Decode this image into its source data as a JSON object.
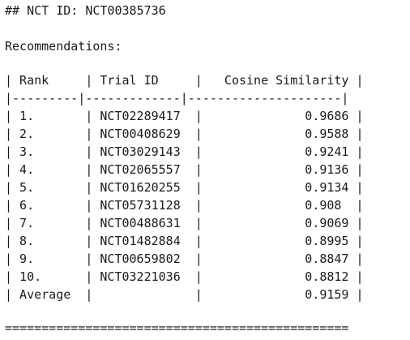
{
  "heading": "## NCT ID: NCT00385736",
  "recommendations_label": "Recommendations:",
  "table": {
    "header_line": "| Rank     | Trial ID     |   Cosine Similarity |",
    "separator_line": "|---------|-------------|---------------------|",
    "rows": [
      "| 1.       | NCT02289417  |              0.9686 |",
      "| 2.       | NCT00408629  |              0.9588 |",
      "| 3.       | NCT03029143  |              0.9241 |",
      "| 4.       | NCT02065557  |              0.9136 |",
      "| 5.       | NCT01620255  |              0.9134 |",
      "| 6.       | NCT05731128  |              0.908  |",
      "| 7.       | NCT00488631  |              0.9069 |",
      "| 8.       | NCT01482884  |              0.8995 |",
      "| 9.       | NCT00659802  |              0.8847 |",
      "| 10.      | NCT03221036  |              0.8812 |",
      "| Average  |              |              0.9159 |"
    ]
  },
  "rule": "==============================================="
}
